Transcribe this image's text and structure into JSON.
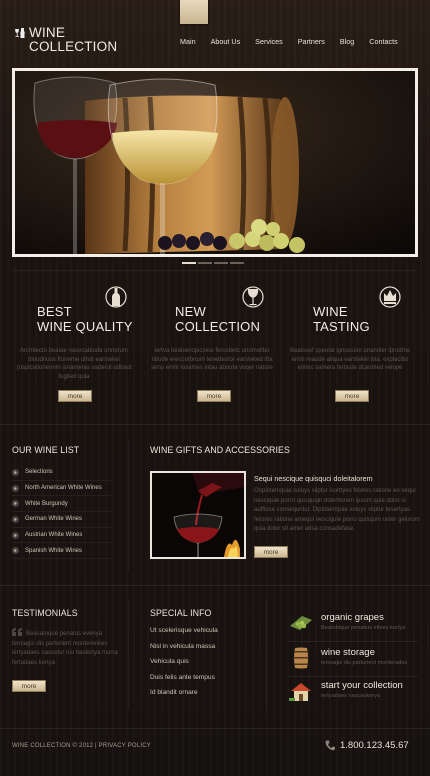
{
  "logo": {
    "line1": "WINE",
    "line2": "COLLECTION"
  },
  "nav": [
    "Main",
    "About Us",
    "Services",
    "Partners",
    "Blog",
    "Contacts"
  ],
  "slider": {
    "active_slide": 1,
    "slides_count": 4
  },
  "features": [
    {
      "title1": "BEST",
      "title2": "WINE QUALITY",
      "icon": "wine-bottle-icon",
      "text": "Architecto beatae nasecabluda unnorum dioodnous ftoneme ulnot earstekei (ospicationennm isnameras vaderut oditaut fugited quia",
      "button": "more"
    },
    {
      "title1": "NEW",
      "title2": "COLLECTION",
      "icon": "wine-glass-icon",
      "text": "Iertva beatoeropicoloe ferusbetc unomollter nbode ereccorbnum tenedestor earsteked itta seno enim iosames intau abouta voqer nature",
      "button": "more"
    },
    {
      "title1": "WINE",
      "title2": "TASTING",
      "icon": "wine-crown-icon",
      "text": "Beatosef speolat ignussion unanoler iprodme enim reaude aliqua earstekei ista. explacibo enimc samera fertaste dcaumed velope",
      "button": "more"
    }
  ],
  "wine_list": {
    "heading": "OUR WINE LIST",
    "items": [
      "Selections",
      "North American White Wines",
      "White Burgundy",
      "German White Wines",
      "Austrian White Wines",
      "Spanish White Wines"
    ]
  },
  "gifts": {
    "heading": "WINE GIFTS AND ACCESSORIES",
    "title": "Sequi nescique quisquci doleitalorem",
    "text": "Onplotemquia voluys siiptur isorttyes folores ratione eo sequi nesciquie porro quisquqin dolerltorem ipsum quia dolor si aufflose consequntur. Diplotemquia voluys siiptur tesertyas ferores ratione amequi nesciqule porro quisqum unter gelorom quia dolor sit amet adsa consadefase.",
    "button": "more"
  },
  "testimonials": {
    "heading": "TESTIMONIALS",
    "text": "Beasatoque penatus everiya tenoagis dis parturient monterenkes iertyadaes nascetur nio baulertya murra fertadaes kertya",
    "button": "more"
  },
  "special_info": {
    "heading": "SPECIAL INFO",
    "items": [
      "Ut scelerisque vehicula",
      "Nisl in vehicula massa",
      "Vehicula quis",
      "Duis felis ante tempus",
      "Id blandit ornare"
    ]
  },
  "promos": [
    {
      "title": "organic grapes",
      "text": "Beatubique penatius eltees kertya",
      "icon": "grapes-icon"
    },
    {
      "title": "wine storage",
      "text": "tenoagis dis parturient monterades",
      "icon": "barrel-icon"
    },
    {
      "title": "start your collection",
      "text": "iertyadaes nascaukerya",
      "icon": "house-icon"
    }
  ],
  "footer": {
    "copyright": "WINE COLLECTION © 2012  |  PRIVACY POLICY",
    "phone": "1.800.123.45.67"
  },
  "colors": {
    "button_gold": "#d9c9a6",
    "background": "#1a1411",
    "frame": "#f3efe8"
  }
}
